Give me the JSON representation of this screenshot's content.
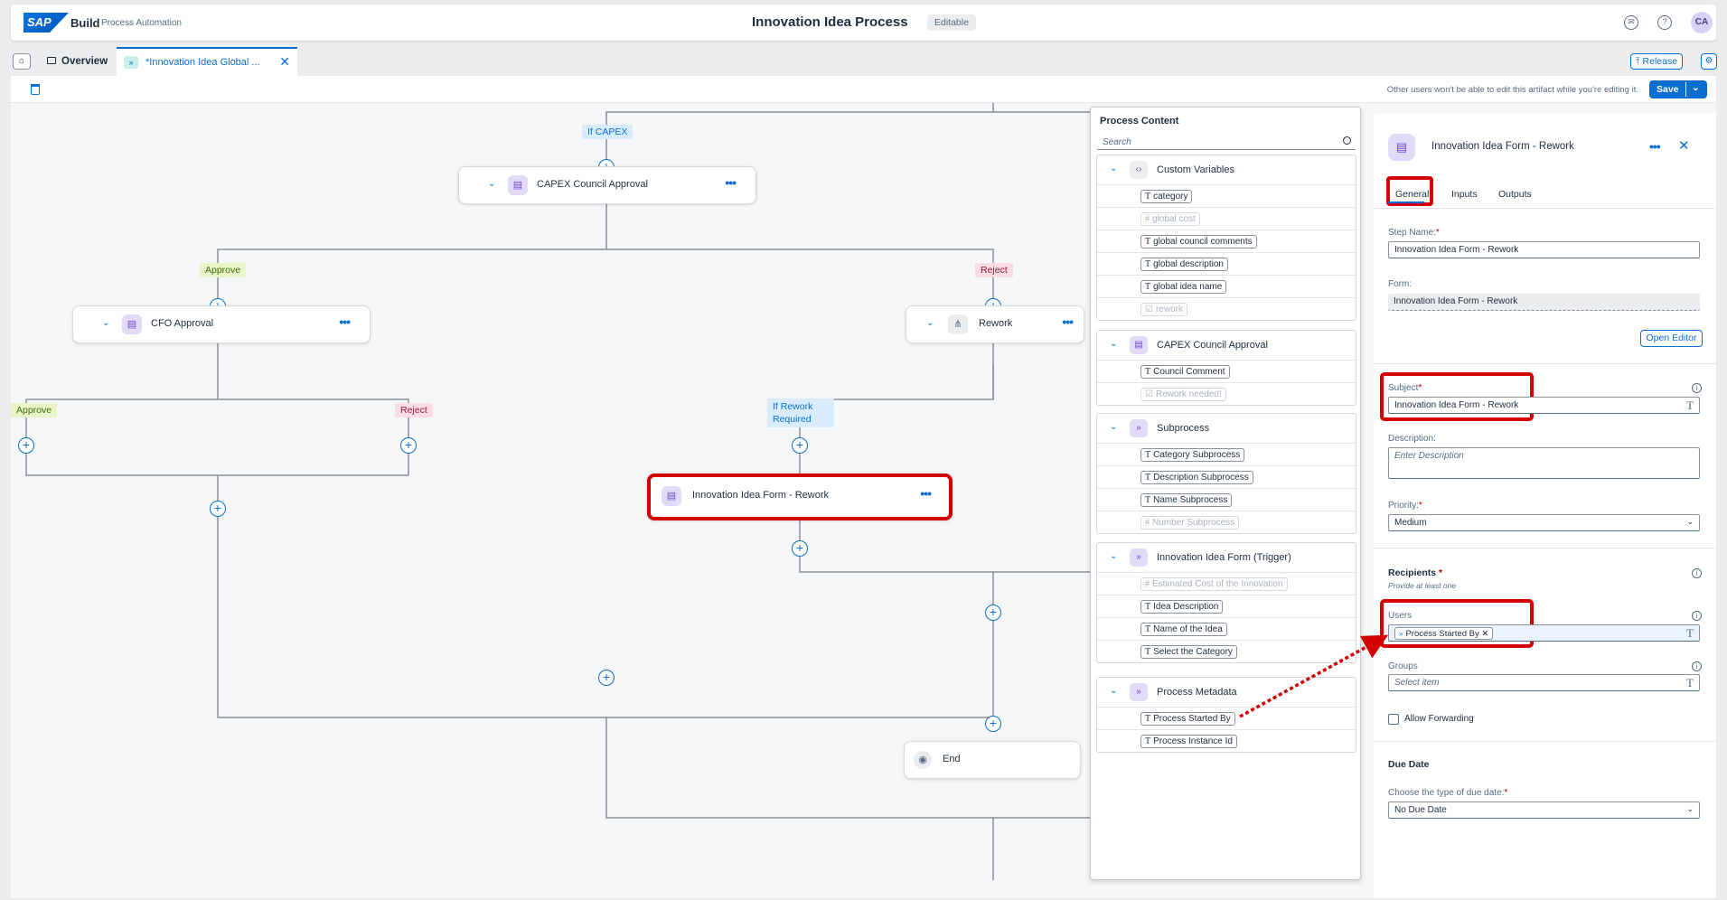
{
  "shell": {
    "logo": "SAP",
    "product": "Build",
    "product_sub": "Process Automation",
    "title": "Innovation Idea Process",
    "status": "Editable",
    "avatar": "CA"
  },
  "tabs": {
    "overview": "Overview",
    "active": "*Innovation Idea Global ...",
    "release": "Release"
  },
  "toolbar": {
    "notice": "Other users won't be able to edit this artifact while you're editing it.",
    "save": "Save"
  },
  "flow": {
    "labels": {
      "if_capex": "If CAPEX",
      "approve_1": "Approve",
      "reject_1": "Reject",
      "approve_2": "Approve",
      "reject_2": "Reject",
      "if_rework_line1": "If Rework",
      "if_rework_line2": "Required"
    },
    "nodes": {
      "capex": "CAPEX Council Approval",
      "cfo": "CFO Approval",
      "rework": "Rework",
      "form_rework": "Innovation Idea Form - Rework",
      "end": "End"
    }
  },
  "process_content": {
    "title": "Process Content",
    "search_placeholder": "Search",
    "groups": [
      {
        "label": "Custom Variables",
        "icon": "code-icon",
        "items": [
          {
            "label": "category",
            "type": "T",
            "disabled": false
          },
          {
            "label": "global cost",
            "type": "#",
            "disabled": true
          },
          {
            "label": "global council comments",
            "type": "T",
            "disabled": false
          },
          {
            "label": "global description",
            "type": "T",
            "disabled": false
          },
          {
            "label": "global idea name",
            "type": "T",
            "disabled": false
          },
          {
            "label": "rework",
            "type": "☑",
            "disabled": true
          }
        ]
      },
      {
        "label": "CAPEX Council Approval",
        "icon": "form-icon",
        "items": [
          {
            "label": "Council Comment",
            "type": "T",
            "disabled": false
          },
          {
            "label": "Rework needed!",
            "type": "☑",
            "disabled": true
          }
        ]
      },
      {
        "label": "Subprocess",
        "icon": "subprocess-icon",
        "items": [
          {
            "label": "Category Subprocess",
            "type": "T",
            "disabled": false
          },
          {
            "label": "Description Subprocess",
            "type": "T",
            "disabled": false
          },
          {
            "label": "Name Subprocess",
            "type": "T",
            "disabled": false
          },
          {
            "label": "Number Subprocess",
            "type": "#",
            "disabled": true
          }
        ]
      },
      {
        "label": "Innovation Idea Form (Trigger)",
        "icon": "subprocess-icon",
        "items": [
          {
            "label": "Estimated Cost of the Innovation",
            "type": "#",
            "disabled": true
          },
          {
            "label": "Idea Description",
            "type": "T",
            "disabled": false
          },
          {
            "label": "Name of the Idea",
            "type": "T",
            "disabled": false
          },
          {
            "label": "Select the Category",
            "type": "T",
            "disabled": false
          }
        ]
      },
      {
        "label": "Process Metadata",
        "icon": "subprocess-icon",
        "items": [
          {
            "label": "Process Started By",
            "type": "T",
            "disabled": false
          },
          {
            "label": "Process Instance Id",
            "type": "T",
            "disabled": false
          }
        ]
      }
    ]
  },
  "properties": {
    "title": "Innovation Idea Form - Rework",
    "tabs": [
      "General",
      "Inputs",
      "Outputs"
    ],
    "step_name_label": "Step Name:",
    "step_name_value": "Innovation Idea Form - Rework",
    "form_label": "Form:",
    "form_value": "Innovation Idea Form - Rework",
    "open_editor": "Open Editor",
    "subject_label": "Subject",
    "subject_value": "Innovation Idea Form - Rework",
    "description_label": "Description:",
    "description_placeholder": "Enter Description",
    "priority_label": "Priority:",
    "priority_value": "Medium",
    "recipients_title": "Recipients",
    "recipients_hint": "Provide at least one",
    "users_label": "Users",
    "users_token": "Process Started By",
    "groups_label": "Groups",
    "groups_placeholder": "Select item",
    "allow_forwarding": "Allow Forwarding",
    "due_date_title": "Due Date",
    "due_type_label": "Choose the type of due date:",
    "due_type_value": "No Due Date"
  },
  "colors": {
    "accent": "#0a6ed1",
    "highlight": "#d40000",
    "approve": "#e8f5c8",
    "reject": "#fadce3"
  }
}
